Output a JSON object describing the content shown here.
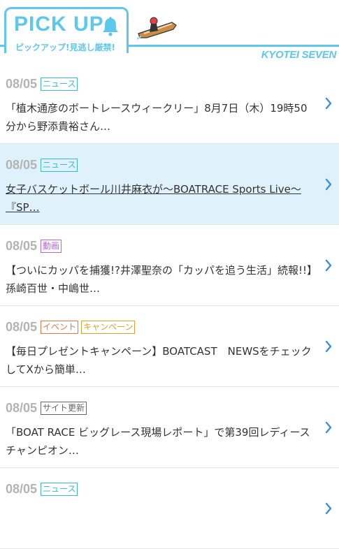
{
  "header": {
    "title": "PICK UP",
    "subtitle": "ピックアップ!見逃し厳禁!",
    "brand": "KYOTEI SEVEN"
  },
  "colors": {
    "accent": "#5ec8ec",
    "highlight_bg": "#dff2fb",
    "chevron": "#3d8fd3",
    "date": "#b3b3b3"
  },
  "items": [
    {
      "date": "08/05",
      "tags": [
        {
          "label": "ニュース",
          "color": "#3fb9c9"
        }
      ],
      "headline": "「植木通彦のボートレースウィークリー」8月7日（木）19時50分から野添貴裕さん…",
      "highlighted": false
    },
    {
      "date": "08/05",
      "tags": [
        {
          "label": "ニュース",
          "color": "#3fb9c9"
        }
      ],
      "headline": "女子バスケットボール川井麻衣が〜BOATRACE Sports Live〜『SP…",
      "highlighted": true
    },
    {
      "date": "08/05",
      "tags": [
        {
          "label": "動画",
          "color": "#b36ad6"
        }
      ],
      "headline": "【ついにカッパを捕獲!?井澤聖奈の「カッパを追う生活」続報!!】孫崎百世・中嶋世…",
      "highlighted": false
    },
    {
      "date": "08/05",
      "tags": [
        {
          "label": "イベント",
          "color": "#e3774a"
        },
        {
          "label": "キャンペーン",
          "color": "#e0a02a"
        }
      ],
      "headline": "【毎日プレゼントキャンペーン】BOATCAST　NEWSをチェックしてXから簡単…",
      "highlighted": false
    },
    {
      "date": "08/05",
      "tags": [
        {
          "label": "サイト更新",
          "color": "#666666"
        }
      ],
      "headline": "「BOAT RACE ビッグレース現場レポート」で第39回レディースチャンピオン…",
      "highlighted": false
    },
    {
      "date": "08/05",
      "tags": [
        {
          "label": "ニュース",
          "color": "#3fb9c9"
        }
      ],
      "headline": "",
      "highlighted": false
    }
  ]
}
